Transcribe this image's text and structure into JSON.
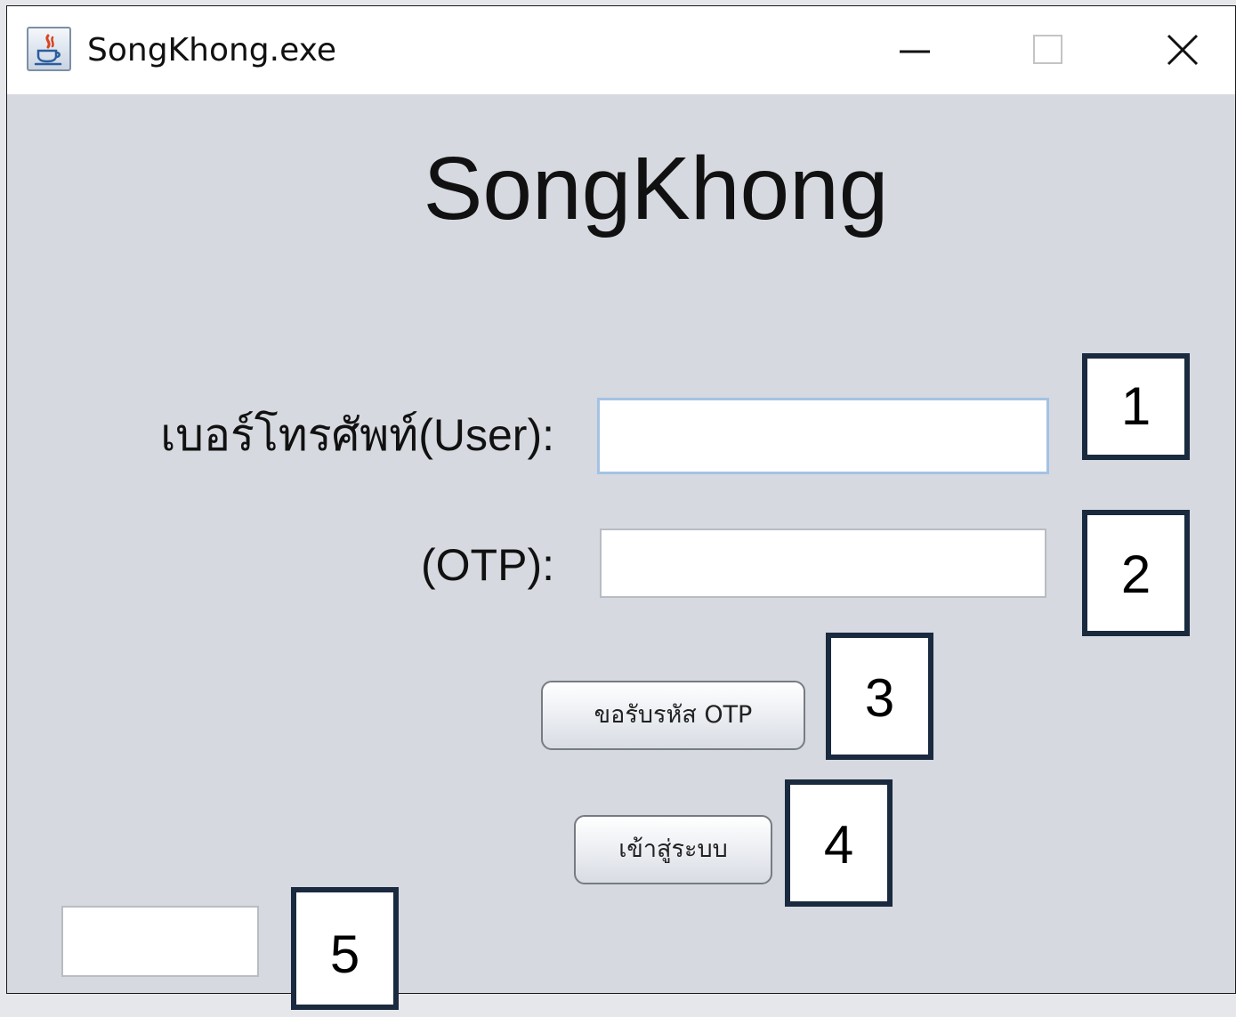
{
  "window": {
    "title": "SongKhong.exe",
    "icon": "java-icon",
    "controls": [
      "minimize-icon",
      "maximize-icon",
      "close-icon"
    ]
  },
  "app": {
    "heading": "SongKhong"
  },
  "form": {
    "user_label": "เบอร์โทรศัพท์(User):",
    "user_value": "",
    "otp_label": "(OTP):",
    "otp_value": "",
    "request_otp_label": "ขอรับรหัส OTP",
    "login_label": "เข้าสู่ระบบ",
    "small_field_value": ""
  },
  "callouts": [
    "1",
    "2",
    "3",
    "4",
    "5"
  ]
}
